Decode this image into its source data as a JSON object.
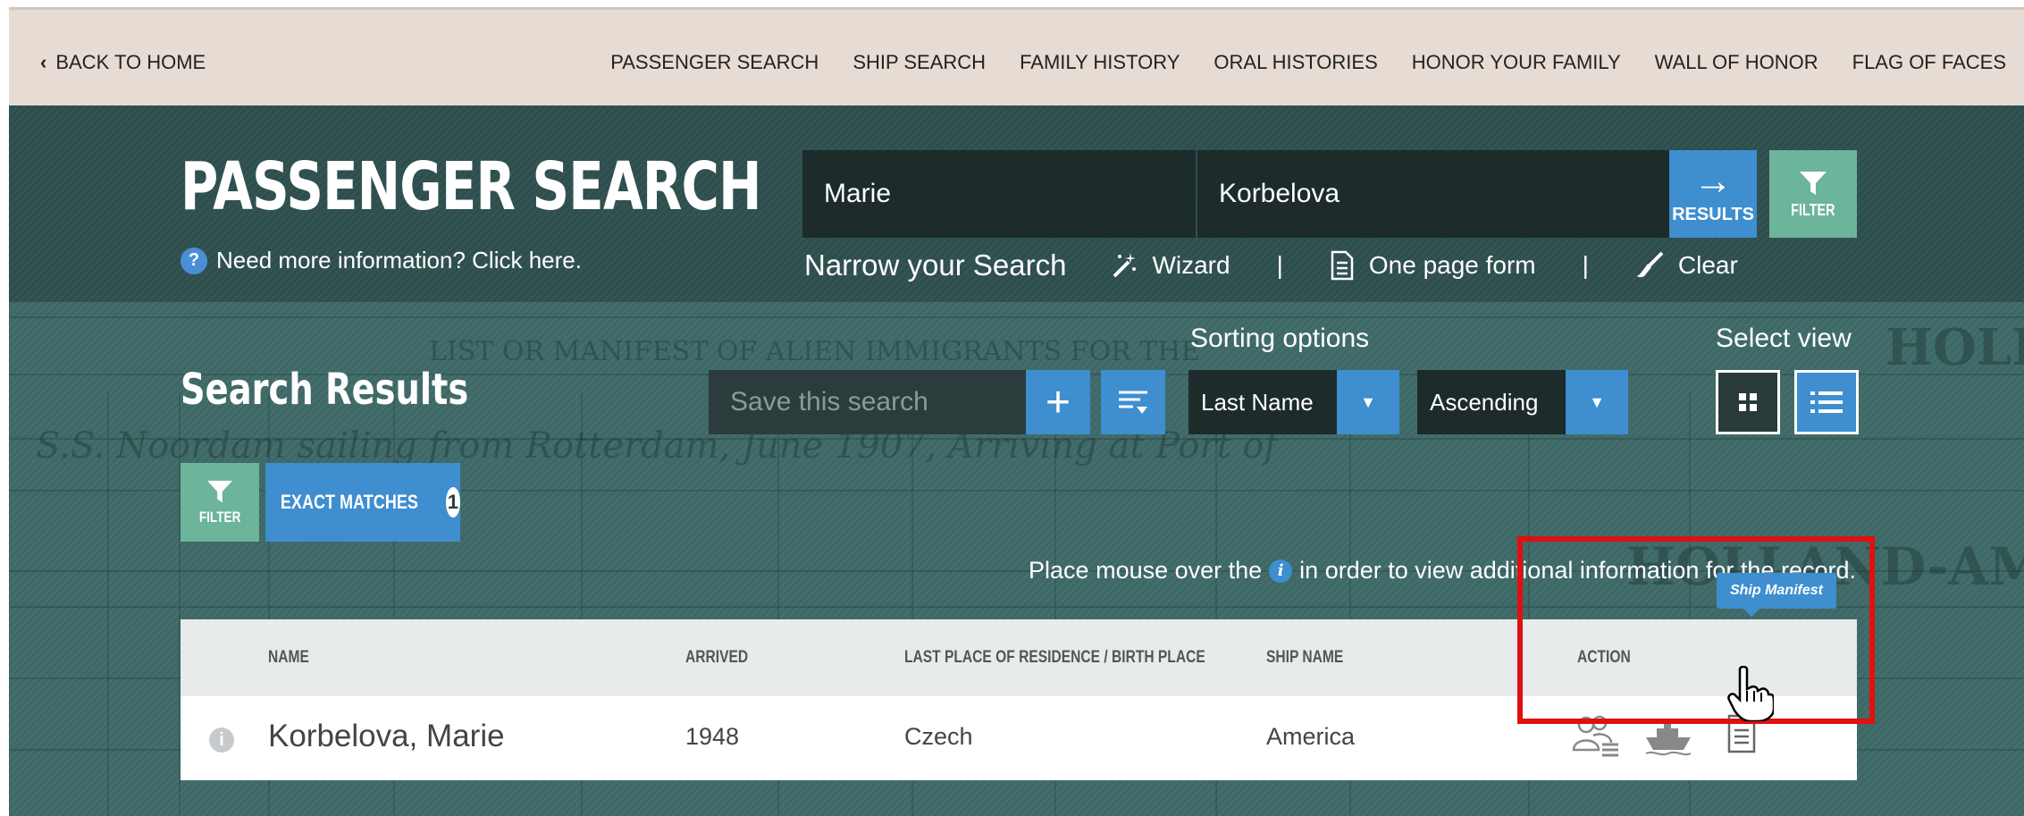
{
  "topnav": {
    "back_label": "BACK TO HOME",
    "links": [
      "PASSENGER SEARCH",
      "SHIP SEARCH",
      "FAMILY HISTORY",
      "ORAL HISTORIES",
      "HONOR YOUR FAMILY",
      "WALL OF HONOR",
      "FLAG OF FACES"
    ]
  },
  "search": {
    "title": "PASSENGER SEARCH",
    "help_text": "Need more information? Click here.",
    "first_name": "Marie",
    "last_name": "Korbelova",
    "results_label": "RESULTS",
    "filter_label": "FILTER",
    "narrow_title": "Narrow your Search",
    "wizard_label": "Wizard",
    "one_page_label": "One page form",
    "clear_label": "Clear",
    "separator": "|"
  },
  "results": {
    "title": "Search Results",
    "save_placeholder": "Save this search",
    "sorting_label": "Sorting options",
    "sort_field": "Last Name",
    "sort_order": "Ascending",
    "select_view_label": "Select view",
    "filter_label": "FILTER",
    "exact_label": "EXACT MATCHES",
    "exact_count": "1",
    "hint_before": "Place mouse over the",
    "hint_after": "in order to view additional information for the record.",
    "info_glyph": "i"
  },
  "table": {
    "headers": [
      "NAME",
      "ARRIVED",
      "LAST PLACE OF RESIDENCE / BIRTH PLACE",
      "SHIP NAME",
      "ACTION"
    ],
    "rows": [
      {
        "name": "Korbelova, Marie",
        "arrived": "1948",
        "place": "Czech",
        "ship": "America"
      }
    ]
  },
  "tooltip": "Ship Manifest",
  "background_text": {
    "manifest_heading": "LIST OR MANIFEST OF ALIEN IMMIGRANTS FOR THE",
    "ship_line": "S.S. Noordam sailing from Rotterdam, June 1907, Arriving at Port of",
    "holland": "HOLLA",
    "holland_america": "HOLLAND-AMER"
  },
  "colors": {
    "nav_bg": "#e6dcd3",
    "hero_dark": "#2f4f4f",
    "hero_teal": "#3f6a68",
    "accent_blue": "#3e8ed0",
    "accent_green": "#6cb49a",
    "highlight_red": "#e01010"
  },
  "icons": {
    "back": "chevron-left-icon",
    "help": "question-circle-icon",
    "results": "arrow-right-icon",
    "filter": "funnel-icon",
    "wizard": "magic-wand-icon",
    "one_page": "document-icon",
    "clear": "brush-icon",
    "add": "plus-icon",
    "sort": "sort-lines-icon",
    "grid_view": "grid-icon",
    "list_view": "list-icon",
    "family": "family-group-icon",
    "ship": "ship-icon",
    "manifest": "document-icon",
    "cursor": "hand-pointer-icon"
  }
}
